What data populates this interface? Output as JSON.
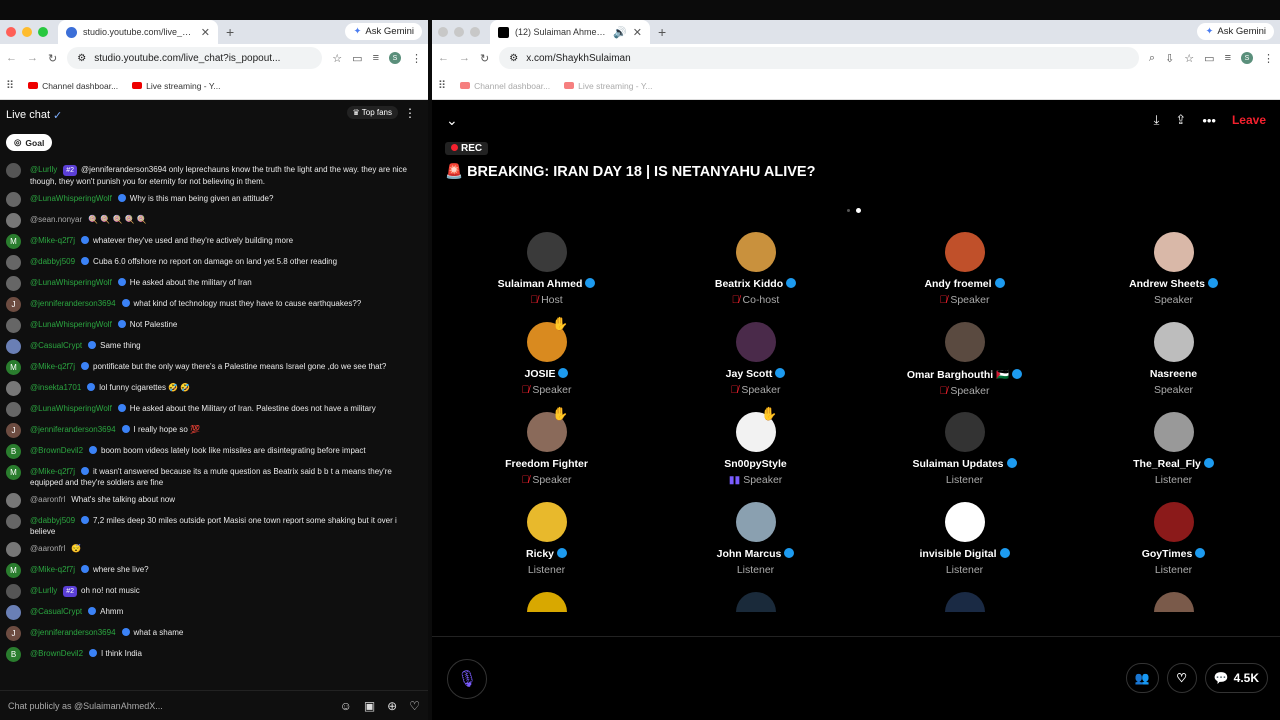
{
  "left": {
    "tab_title": "studio.youtube.com/live_chat",
    "url": "studio.youtube.com/live_chat?is_popout...",
    "ask_gemini": "Ask Gemini",
    "bookmarks": [
      "Channel dashboar...",
      "Live streaming - Y..."
    ],
    "chat": {
      "title": "Live chat",
      "top_fans": "Top fans",
      "goal": "Goal",
      "placeholder": "Chat publicly as @SulaimanAhmedX...",
      "messages": [
        {
          "author": "@Lurlly",
          "badge": "#2",
          "text": "@jenniferanderson3694 only leprechauns know the truth the light and the way. they are nice though, they won't punish you for eternity for not believing in them.",
          "color": "#555"
        },
        {
          "author": "@LunaWhisperingWolf",
          "text": "Why is this man being given an attitude?",
          "color": "#666"
        },
        {
          "author": "@sean.nonyar",
          "text": "🍭 🍭 🍭 🍭 🍭",
          "color": "#777",
          "gray": true
        },
        {
          "author": "@Mike-q2f7j",
          "text": "whatever they've used and they're actively building more",
          "color": "#2a7d2e",
          "letter": "M"
        },
        {
          "author": "@dabbyj509",
          "text": "Cuba 6.0 offshore no report on damage on land yet 5.8 other reading",
          "color": "#666"
        },
        {
          "author": "@LunaWhisperingWolf",
          "text": "He asked about the military of Iran",
          "color": "#666"
        },
        {
          "author": "@jenniferanderson3694",
          "text": "what kind of technology must they have to cause earthquakes??",
          "color": "#6d4c41",
          "letter": "J"
        },
        {
          "author": "@LunaWhisperingWolf",
          "text": "Not Palestine",
          "color": "#666"
        },
        {
          "author": "@CasualCrypt",
          "text": "Same thing",
          "color": "#6a7fb5"
        },
        {
          "author": "@Mike-q2f7j",
          "text": "pontificate but the only way there's a Palestine means Israel gone ,do we see that?",
          "color": "#2a7d2e",
          "letter": "M"
        },
        {
          "author": "@insekta1701",
          "text": "lol funny cigarettes 🤣 🤣",
          "color": "#777"
        },
        {
          "author": "@LunaWhisperingWolf",
          "text": "He asked about the Military of Iran. Palestine does not have a military",
          "color": "#666"
        },
        {
          "author": "@jenniferanderson3694",
          "text": "I really hope so 💯",
          "color": "#6d4c41",
          "letter": "J"
        },
        {
          "author": "@BrownDevil2",
          "text": "boom boom videos lately look like missiles are disintegrating before impact",
          "color": "#2a7d2e",
          "letter": "B"
        },
        {
          "author": "@Mike-q2f7j",
          "text": "it wasn't answered because its a mute question as Beatrix said b b t a means they're equipped and they're soldiers are fine",
          "color": "#2a7d2e",
          "letter": "M"
        },
        {
          "author": "@aaronfrl",
          "text": "What's she talking about now",
          "color": "#777",
          "gray": true
        },
        {
          "author": "@dabbyj509",
          "text": "7,2 miles deep 30 miles outside port Masisi one town report some shaking but it over i believe",
          "color": "#666"
        },
        {
          "author": "@aaronfrl",
          "text": "😴",
          "color": "#777",
          "gray": true
        },
        {
          "author": "@Mike-q2f7j",
          "text": "where she live?",
          "color": "#2a7d2e",
          "letter": "M"
        },
        {
          "author": "@Lurlly",
          "badge": "#2",
          "text": "oh no! not music",
          "color": "#555"
        },
        {
          "author": "@CasualCrypt",
          "text": "Ahmm",
          "color": "#6a7fb5"
        },
        {
          "author": "@jenniferanderson3694",
          "text": "what a shame",
          "color": "#6d4c41",
          "letter": "J"
        },
        {
          "author": "@BrownDevil2",
          "text": "I think India",
          "color": "#2a7d2e",
          "letter": "B"
        }
      ]
    }
  },
  "right": {
    "tab_title": "(12) Sulaiman Ahmed (@S...",
    "url": "x.com/ShaykhSulaiman",
    "ask_gemini": "Ask Gemini",
    "bookmarks": [
      "Channel dashboar...",
      "Live streaming - Y..."
    ],
    "leave": "Leave",
    "rec": "REC",
    "title": "🚨 BREAKING: IRAN DAY 18 | IS NETANYAHU ALIVE?",
    "count": "4.5K",
    "people": [
      {
        "name": "Sulaiman Ahmed",
        "role": "Host",
        "verified": true,
        "muted": true,
        "color": "#3a3a3a"
      },
      {
        "name": "Beatrix Kiddo",
        "role": "Co-host",
        "verified": true,
        "muted": true,
        "color": "#c9913d"
      },
      {
        "name": "Andy froemel",
        "role": "Speaker",
        "verified": true,
        "muted": true,
        "color": "#c0502a"
      },
      {
        "name": "Andrew Sheets",
        "role": "Speaker",
        "verified": true,
        "muted": false,
        "color": "#d9b8a8"
      },
      {
        "name": "JOSIE",
        "role": "Speaker",
        "verified": true,
        "muted": true,
        "hand": true,
        "color": "#d98a1f"
      },
      {
        "name": "Jay Scott",
        "role": "Speaker",
        "verified": true,
        "muted": true,
        "color": "#4a2a4a"
      },
      {
        "name": "Omar Barghouthi 🇵🇸",
        "role": "Speaker",
        "verified": true,
        "muted": true,
        "color": "#5a4a40"
      },
      {
        "name": "Nasreene",
        "role": "Speaker",
        "verified": false,
        "muted": false,
        "color": "#bdbdbd"
      },
      {
        "name": "Freedom Fighter",
        "role": "Speaker",
        "verified": false,
        "muted": true,
        "hand": true,
        "color": "#8a6a5a"
      },
      {
        "name": "Sn00pyStyle",
        "role": "Speaker",
        "verified": false,
        "muted": false,
        "hand": true,
        "speaking": true,
        "color": "#f2f2f2"
      },
      {
        "name": "Sulaiman Updates",
        "role": "Listener",
        "verified": true,
        "muted": false,
        "color": "#333"
      },
      {
        "name": "The_Real_Fly",
        "role": "Listener",
        "verified": true,
        "muted": false,
        "color": "#999"
      },
      {
        "name": "Ricky",
        "role": "Listener",
        "verified": true,
        "muted": false,
        "color": "#e8b92c"
      },
      {
        "name": "John Marcus",
        "role": "Listener",
        "verified": true,
        "muted": false,
        "color": "#8aa0b0"
      },
      {
        "name": "invisible Digital",
        "role": "Listener",
        "verified": true,
        "muted": false,
        "color": "#fff"
      },
      {
        "name": "GoyTimes",
        "role": "Listener",
        "verified": true,
        "muted": false,
        "color": "#8b1a1a"
      },
      {
        "name": "",
        "role": "",
        "verified": false,
        "muted": false,
        "color": "#d8a800"
      },
      {
        "name": "",
        "role": "",
        "verified": false,
        "muted": false,
        "color": "#1a2a3a"
      },
      {
        "name": "",
        "role": "",
        "verified": false,
        "muted": false,
        "color": "#1a2a44"
      },
      {
        "name": "",
        "role": "",
        "verified": false,
        "muted": false,
        "color": "#7a5a4a"
      }
    ]
  }
}
